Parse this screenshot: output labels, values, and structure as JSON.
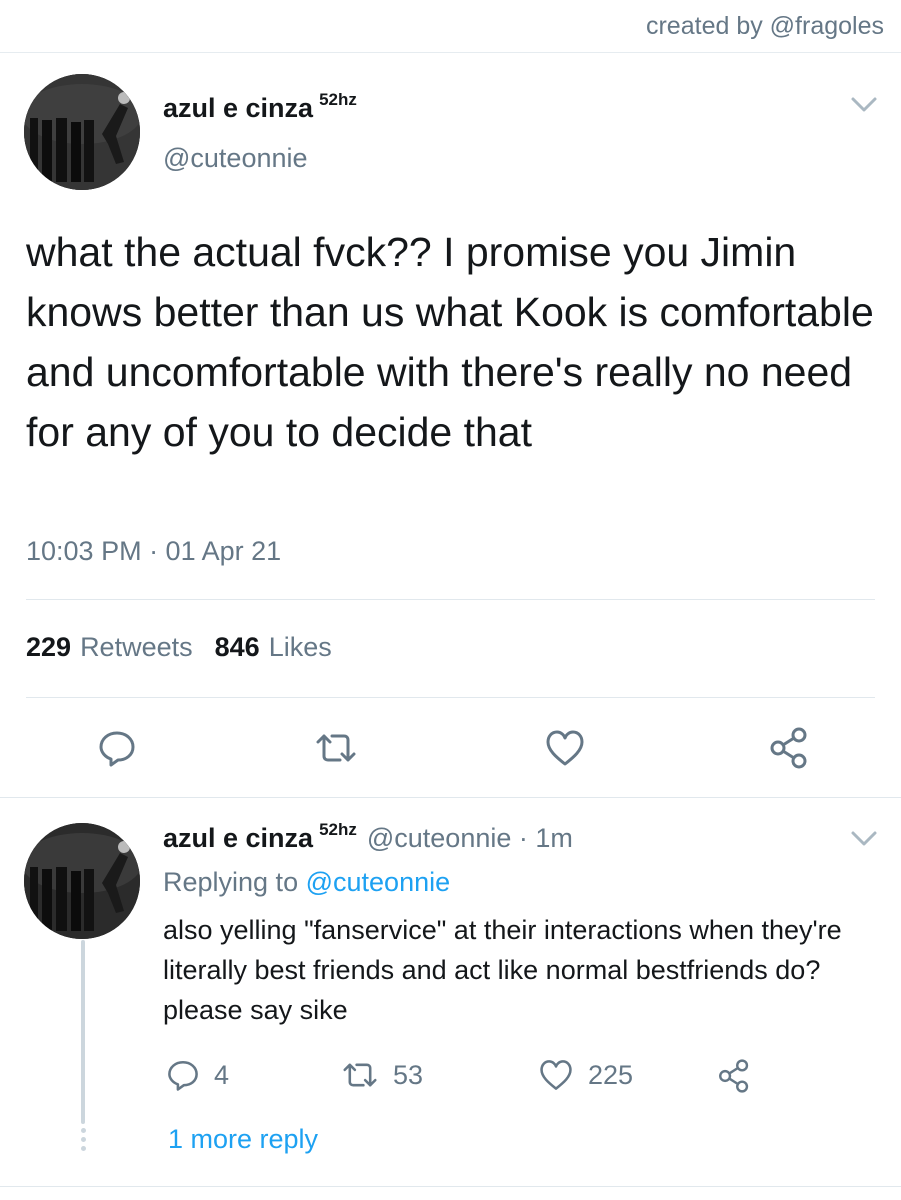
{
  "credit": "created by @fragoles",
  "main_tweet": {
    "display_name": "azul e cinza",
    "name_suffix": "52hz",
    "handle": "@cuteonnie",
    "text": "what the actual fvck?? I promise you Jimin knows better than us what Kook is comfortable and uncomfortable with there's really no need for any of you to decide that",
    "timestamp": "10:03 PM · 01 Apr 21",
    "stats": {
      "retweets_count": "229",
      "retweets_label": "Retweets",
      "likes_count": "846",
      "likes_label": "Likes"
    },
    "icons": {
      "reply": "reply-icon",
      "retweet": "retweet-icon",
      "like": "heart-icon",
      "share": "share-icon",
      "menu": "chevron-down-icon"
    }
  },
  "reply_tweet": {
    "display_name": "azul e cinza",
    "name_suffix": "52hz",
    "handle": "@cuteonnie",
    "time_ago": "1m",
    "replying_prefix": "Replying to",
    "replying_to": "@cuteonnie",
    "text": "also yelling \"fanservice\" at their interactions when they're literally best friends and act like normal bestfriends do? please say sike",
    "actions": {
      "replies": "4",
      "retweets": "53",
      "likes": "225"
    },
    "more_replies": "1 more reply"
  },
  "colors": {
    "text_primary": "#14171a",
    "text_secondary": "#657786",
    "link": "#1da1f2",
    "divider": "#e1e8ed"
  }
}
